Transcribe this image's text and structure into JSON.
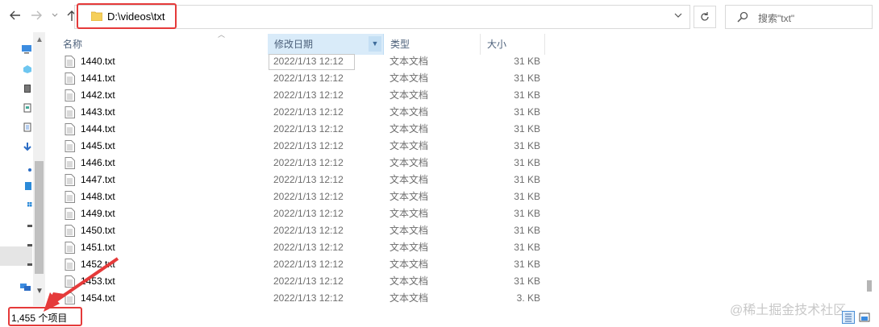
{
  "addressbar": {
    "path": "D:\\videos\\txt",
    "search_placeholder": "搜索\"txt\""
  },
  "columns": {
    "name": "名称",
    "date": "修改日期",
    "type": "类型",
    "size": "大小"
  },
  "files": [
    {
      "name": "1440.txt",
      "date": "2022/1/13 12:12",
      "type": "文本文档",
      "size": "31 KB"
    },
    {
      "name": "1441.txt",
      "date": "2022/1/13 12:12",
      "type": "文本文档",
      "size": "31 KB"
    },
    {
      "name": "1442.txt",
      "date": "2022/1/13 12:12",
      "type": "文本文档",
      "size": "31 KB"
    },
    {
      "name": "1443.txt",
      "date": "2022/1/13 12:12",
      "type": "文本文档",
      "size": "31 KB"
    },
    {
      "name": "1444.txt",
      "date": "2022/1/13 12:12",
      "type": "文本文档",
      "size": "31 KB"
    },
    {
      "name": "1445.txt",
      "date": "2022/1/13 12:12",
      "type": "文本文档",
      "size": "31 KB"
    },
    {
      "name": "1446.txt",
      "date": "2022/1/13 12:12",
      "type": "文本文档",
      "size": "31 KB"
    },
    {
      "name": "1447.txt",
      "date": "2022/1/13 12:12",
      "type": "文本文档",
      "size": "31 KB"
    },
    {
      "name": "1448.txt",
      "date": "2022/1/13 12:12",
      "type": "文本文档",
      "size": "31 KB"
    },
    {
      "name": "1449.txt",
      "date": "2022/1/13 12:12",
      "type": "文本文档",
      "size": "31 KB"
    },
    {
      "name": "1450.txt",
      "date": "2022/1/13 12:12",
      "type": "文本文档",
      "size": "31 KB"
    },
    {
      "name": "1451.txt",
      "date": "2022/1/13 12:12",
      "type": "文本文档",
      "size": "31 KB"
    },
    {
      "name": "1452.txt",
      "date": "2022/1/13 12:12",
      "type": "文本文档",
      "size": "31 KB"
    },
    {
      "name": "1453.txt",
      "date": "2022/1/13 12:12",
      "type": "文本文档",
      "size": "31 KB"
    },
    {
      "name": "1454.txt",
      "date": "2022/1/13 12:12",
      "type": "文本文档",
      "size": "3. KB"
    }
  ],
  "status": {
    "item_count": "1,455 个项目"
  },
  "watermark": "@稀土掘金技术社区",
  "colors": {
    "highlight": "#e53a3a",
    "sorted_column": "#d9ebf9",
    "header_text": "#4c607a"
  }
}
